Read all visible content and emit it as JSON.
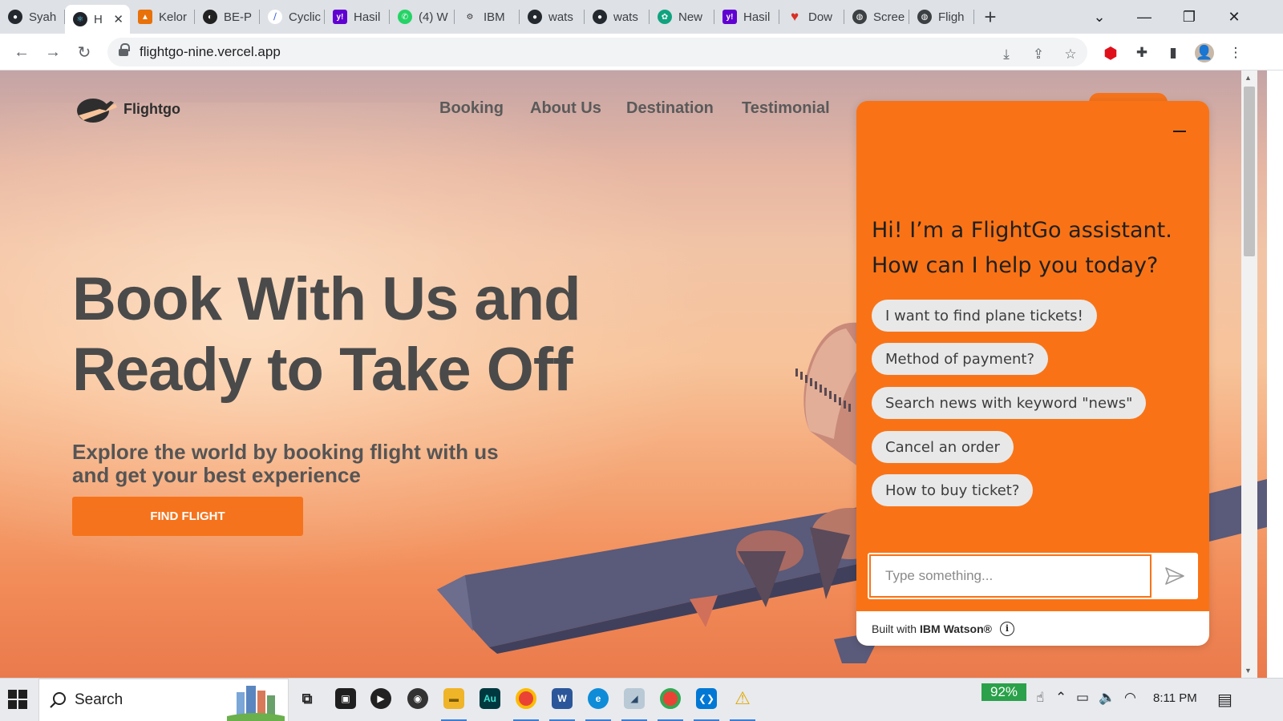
{
  "browser": {
    "tabs": [
      {
        "title": "Syah",
        "favicon": "github-icon",
        "color": "#24292f"
      },
      {
        "title": "H",
        "favicon": "react-icon",
        "color": "#1f6fa8",
        "active": true
      },
      {
        "title": "Kelor",
        "favicon": "app-icon",
        "color": "#e8710a"
      },
      {
        "title": "BE-P",
        "favicon": "app-icon",
        "color": "#222222"
      },
      {
        "title": "Cyclic",
        "favicon": "app-icon",
        "color": "#3b5bdb"
      },
      {
        "title": "Hasil",
        "favicon": "yahoo-icon",
        "color": "#6001d2"
      },
      {
        "title": "(4) W",
        "favicon": "whatsapp-icon",
        "color": "#25d366"
      },
      {
        "title": "IBM",
        "favicon": "app-icon",
        "color": "#555555"
      },
      {
        "title": "wats",
        "favicon": "github-icon",
        "color": "#24292f"
      },
      {
        "title": "wats",
        "favicon": "github-icon",
        "color": "#24292f"
      },
      {
        "title": "New",
        "favicon": "openai-icon",
        "color": "#10a37f"
      },
      {
        "title": "Hasil",
        "favicon": "yahoo-icon",
        "color": "#6001d2"
      },
      {
        "title": "Dow",
        "favicon": "heart-icon",
        "color": "#d93025"
      },
      {
        "title": "Scree",
        "favicon": "globe-icon",
        "color": "#5f6368"
      },
      {
        "title": "Fligh",
        "favicon": "globe-icon",
        "color": "#5f6368"
      }
    ],
    "new_tab_label": "+",
    "url": "flightgo-nine.vercel.app"
  },
  "site": {
    "logo_text": "Flightgo",
    "nav": [
      "Booking",
      "About Us",
      "Destination",
      "Testimonial"
    ],
    "hero_title": "Book With Us and Ready to Take Off",
    "hero_subtitle": "Explore the world by booking flight with us and get your best experience",
    "cta_label": "FIND FLIGHT",
    "accent_color": "#f5731c"
  },
  "chat": {
    "greeting": "Hi! I’m a FlightGo assistant. How can I help you today?",
    "suggestions": [
      "I want to find plane tickets!",
      "Method of payment?",
      "Search news with keyword \"news\"",
      "Cancel an order",
      "How to buy ticket?"
    ],
    "input_placeholder": "Type something...",
    "footer_prefix": "Built with",
    "footer_brand": "IBM Watson®",
    "color": "#f97316"
  },
  "taskbar": {
    "search_label": "Search",
    "battery_percent": "92%",
    "time": "8:11 PM"
  }
}
